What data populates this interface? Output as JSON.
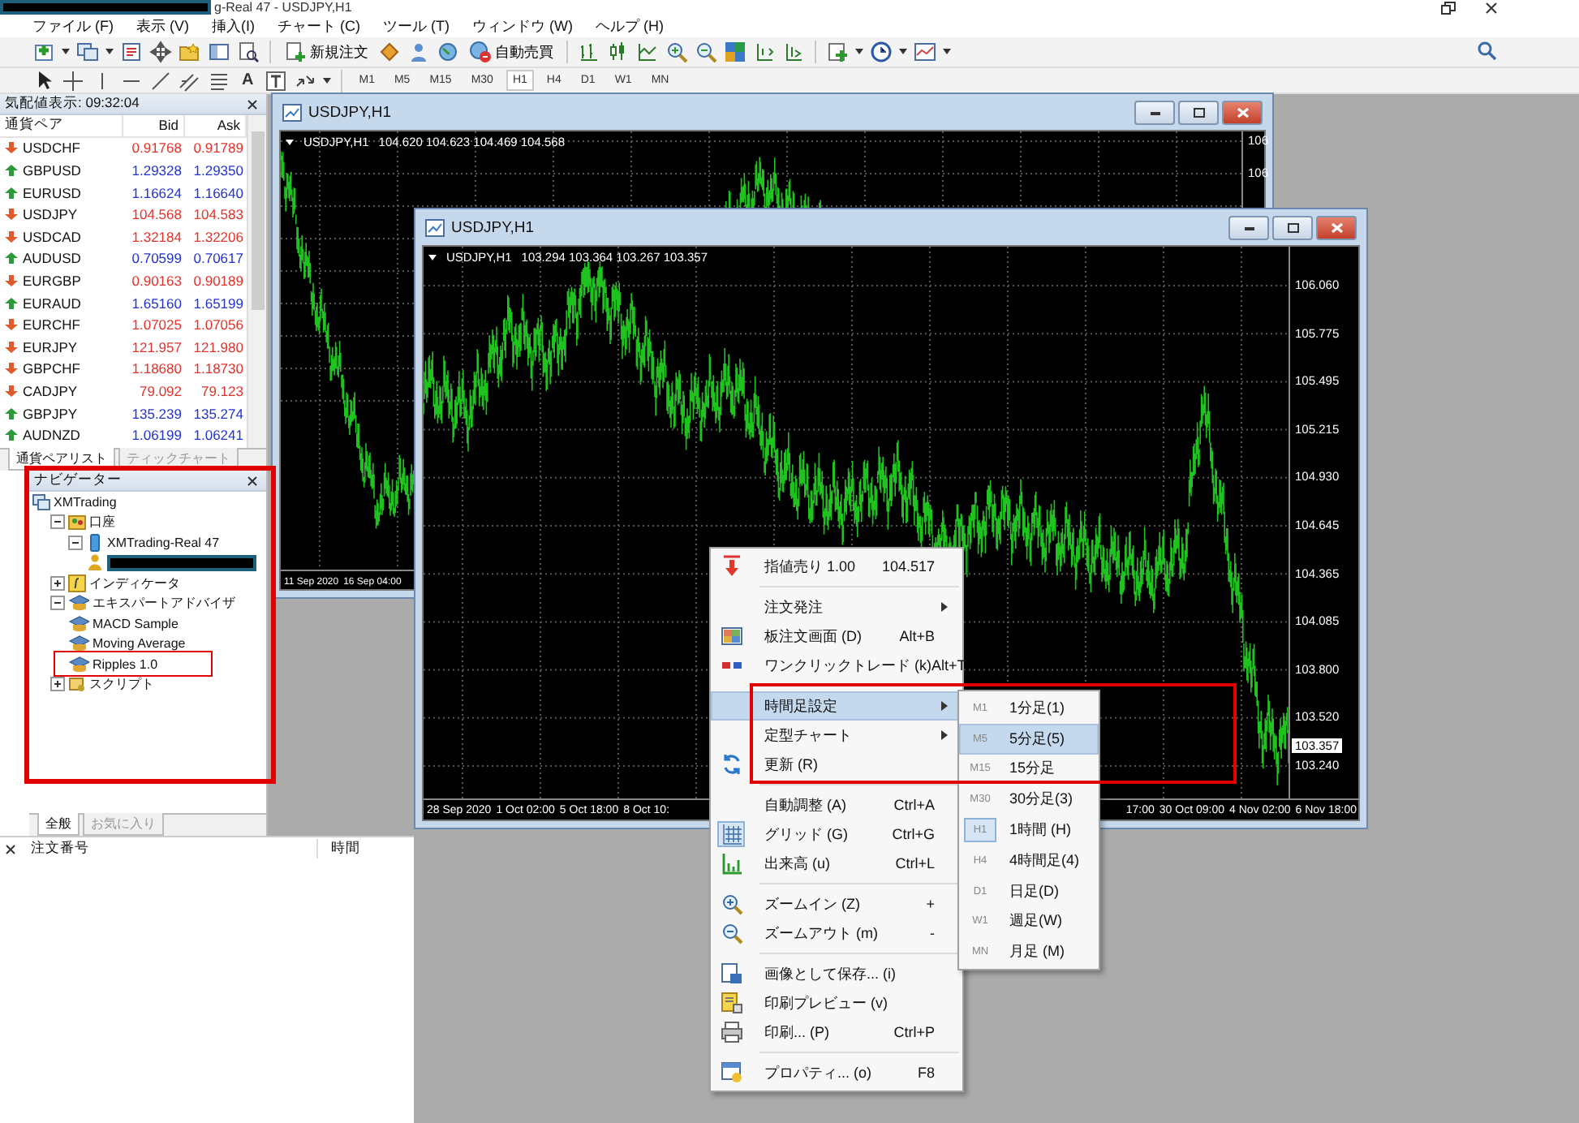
{
  "window": {
    "title": "g-Real 47 - USDJPY,H1"
  },
  "menu": [
    "ファイル (F)",
    "表示 (V)",
    "挿入(I)",
    "チャート (C)",
    "ツール (T)",
    "ウィンドウ (W)",
    "ヘルプ (H)"
  ],
  "toolbar": {
    "new_order": "新規注文",
    "auto_trade": "自動売買",
    "text_tool": "A"
  },
  "timeframes": [
    {
      "label": "M1",
      "selected": false
    },
    {
      "label": "M5",
      "selected": false
    },
    {
      "label": "M15",
      "selected": false
    },
    {
      "label": "M30",
      "selected": false
    },
    {
      "label": "H1",
      "selected": true
    },
    {
      "label": "H4",
      "selected": false
    },
    {
      "label": "D1",
      "selected": false
    },
    {
      "label": "W1",
      "selected": false
    },
    {
      "label": "MN",
      "selected": false
    }
  ],
  "market_watch": {
    "title": "気配値表示: 09:32:04",
    "columns": [
      "通貨ペア",
      "Bid",
      "Ask"
    ],
    "rows": [
      {
        "symbol": "USDCHF",
        "bid": "0.91768",
        "ask": "0.91789",
        "rising": false
      },
      {
        "symbol": "GBPUSD",
        "bid": "1.29328",
        "ask": "1.29350",
        "rising": true
      },
      {
        "symbol": "EURUSD",
        "bid": "1.16624",
        "ask": "1.16640",
        "rising": true
      },
      {
        "symbol": "USDJPY",
        "bid": "104.568",
        "ask": "104.583",
        "rising": false
      },
      {
        "symbol": "USDCAD",
        "bid": "1.32184",
        "ask": "1.32206",
        "rising": false
      },
      {
        "symbol": "AUDUSD",
        "bid": "0.70599",
        "ask": "0.70617",
        "rising": true
      },
      {
        "symbol": "EURGBP",
        "bid": "0.90163",
        "ask": "0.90189",
        "rising": false
      },
      {
        "symbol": "EURAUD",
        "bid": "1.65160",
        "ask": "1.65199",
        "rising": true
      },
      {
        "symbol": "EURCHF",
        "bid": "1.07025",
        "ask": "1.07056",
        "rising": false
      },
      {
        "symbol": "EURJPY",
        "bid": "121.957",
        "ask": "121.980",
        "rising": false
      },
      {
        "symbol": "GBPCHF",
        "bid": "1.18680",
        "ask": "1.18730",
        "rising": false
      },
      {
        "symbol": "CADJPY",
        "bid": "79.092",
        "ask": "79.123",
        "rising": false
      },
      {
        "symbol": "GBPJPY",
        "bid": "135.239",
        "ask": "135.274",
        "rising": true
      },
      {
        "symbol": "AUDNZD",
        "bid": "1.06199",
        "ask": "1.06241",
        "rising": true
      }
    ],
    "tabs": [
      {
        "label": "通貨ペアリスト",
        "selected": true
      },
      {
        "label": "ティックチャート",
        "selected": false
      }
    ]
  },
  "navigator": {
    "title": "ナビゲーター",
    "tree": [
      {
        "label": "XMTrading",
        "kind": "terminal",
        "children": [
          {
            "label": "口座",
            "kind": "accounts",
            "expanded": true,
            "children": [
              {
                "label": "XMTrading-Real 47",
                "kind": "server",
                "expanded": true,
                "children": [
                  {
                    "kind": "account"
                  }
                ]
              }
            ]
          },
          {
            "label": "インディケータ",
            "kind": "indicators",
            "expanded": false
          },
          {
            "label": "エキスパートアドバイザ",
            "kind": "experts",
            "expanded": true,
            "children": [
              {
                "label": "MACD Sample",
                "kind": "expert"
              },
              {
                "label": "Moving Average",
                "kind": "expert"
              },
              {
                "label": "Ripples 1.0",
                "kind": "expert"
              }
            ]
          },
          {
            "label": "スクリプト",
            "kind": "scripts",
            "expanded": false
          }
        ]
      }
    ],
    "tabs": [
      {
        "label": "全般",
        "selected": true
      },
      {
        "label": "お気に入り",
        "selected": false
      }
    ]
  },
  "terminal": {
    "columns": [
      "注文番号",
      "時間"
    ]
  },
  "charts": [
    {
      "title": "USDJPY,H1",
      "symbol": "USDJPY,H1",
      "ohlc": "104.620 104.623 104.469 104.568",
      "price_labels": [
        "106",
        "106"
      ],
      "time_labels": [
        "11 Sep 2020",
        "16 Sep 04:00"
      ]
    },
    {
      "title": "USDJPY,H1",
      "symbol": "USDJPY,H1",
      "ohlc": "103.294 103.364 103.267 103.357",
      "price_labels": [
        "106.060",
        "105.775",
        "105.495",
        "105.215",
        "104.930",
        "104.645",
        "104.365",
        "104.085",
        "103.800",
        "103.520",
        "103.240"
      ],
      "current_price": "103.357",
      "time_labels": [
        "28 Sep 2020",
        "1 Oct 02:00",
        "5 Oct 18:00",
        "8 Oct 10:"
      ],
      "time_labels_end": [
        "17:00",
        "30 Oct 09:00",
        "4 Nov 02:00",
        "6 Nov 18:00"
      ]
    }
  ],
  "context_menu": [
    {
      "kind": "item",
      "label": "指値売り 1.00",
      "shortcut": "104.517",
      "submenu": false,
      "checked": false,
      "selected": false
    },
    {
      "kind": "separator"
    },
    {
      "kind": "item",
      "label": "注文発注",
      "submenu": true,
      "checked": false,
      "selected": false
    },
    {
      "kind": "item",
      "label": "板注文画面 (D)",
      "shortcut": "Alt+B",
      "submenu": false,
      "checked": false,
      "selected": false
    },
    {
      "kind": "item",
      "label": "ワンクリックトレード (k)",
      "shortcut": "Alt+T",
      "submenu": false,
      "checked": false,
      "selected": false
    },
    {
      "kind": "separator"
    },
    {
      "kind": "item",
      "label": "時間足設定",
      "submenu": true,
      "checked": false,
      "selected": true
    },
    {
      "kind": "item",
      "label": "定型チャート",
      "submenu": true,
      "checked": false,
      "selected": false
    },
    {
      "kind": "item",
      "label": "更新 (R)",
      "submenu": false,
      "checked": false,
      "selected": false
    },
    {
      "kind": "separator"
    },
    {
      "kind": "item",
      "label": "自動調整 (A)",
      "shortcut": "Ctrl+A",
      "submenu": false,
      "checked": false,
      "selected": false
    },
    {
      "kind": "item",
      "label": "グリッド (G)",
      "shortcut": "Ctrl+G",
      "submenu": false,
      "checked": true,
      "selected": false
    },
    {
      "kind": "item",
      "label": "出来高 (u)",
      "shortcut": "Ctrl+L",
      "submenu": false,
      "checked": false,
      "selected": false
    },
    {
      "kind": "separator"
    },
    {
      "kind": "item",
      "label": "ズームイン (Z)",
      "shortcut": "+",
      "submenu": false,
      "checked": false,
      "selected": false
    },
    {
      "kind": "item",
      "label": "ズームアウト (m)",
      "shortcut": "-",
      "submenu": false,
      "checked": false,
      "selected": false
    },
    {
      "kind": "separator"
    },
    {
      "kind": "item",
      "label": "画像として保存... (i)",
      "submenu": false,
      "checked": false,
      "selected": false
    },
    {
      "kind": "item",
      "label": "印刷プレビュー (v)",
      "submenu": false,
      "checked": false,
      "selected": false
    },
    {
      "kind": "item",
      "label": "印刷... (P)",
      "shortcut": "Ctrl+P",
      "submenu": false,
      "checked": false,
      "selected": false
    },
    {
      "kind": "separator"
    },
    {
      "kind": "item",
      "label": "プロパティ... (o)",
      "shortcut": "F8",
      "submenu": false,
      "checked": false,
      "selected": false
    }
  ],
  "timeframe_menu": [
    {
      "code": "M1",
      "label": "1分足(1)",
      "selected": false,
      "checked": false
    },
    {
      "code": "M5",
      "label": "5分足(5)",
      "selected": true,
      "checked": false
    },
    {
      "code": "M15",
      "label": "15分足",
      "selected": false,
      "checked": false
    },
    {
      "code": "M30",
      "label": "30分足(3)",
      "selected": false,
      "checked": false
    },
    {
      "code": "H1",
      "label": "1時間 (H)",
      "selected": false,
      "checked": true
    },
    {
      "code": "H4",
      "label": "4時間足(4)",
      "selected": false,
      "checked": false
    },
    {
      "code": "D1",
      "label": "日足(D)",
      "selected": false,
      "checked": false
    },
    {
      "code": "W1",
      "label": "週足(W)",
      "selected": false,
      "checked": false
    },
    {
      "code": "MN",
      "label": "月足 (M)",
      "selected": false,
      "checked": false
    }
  ]
}
